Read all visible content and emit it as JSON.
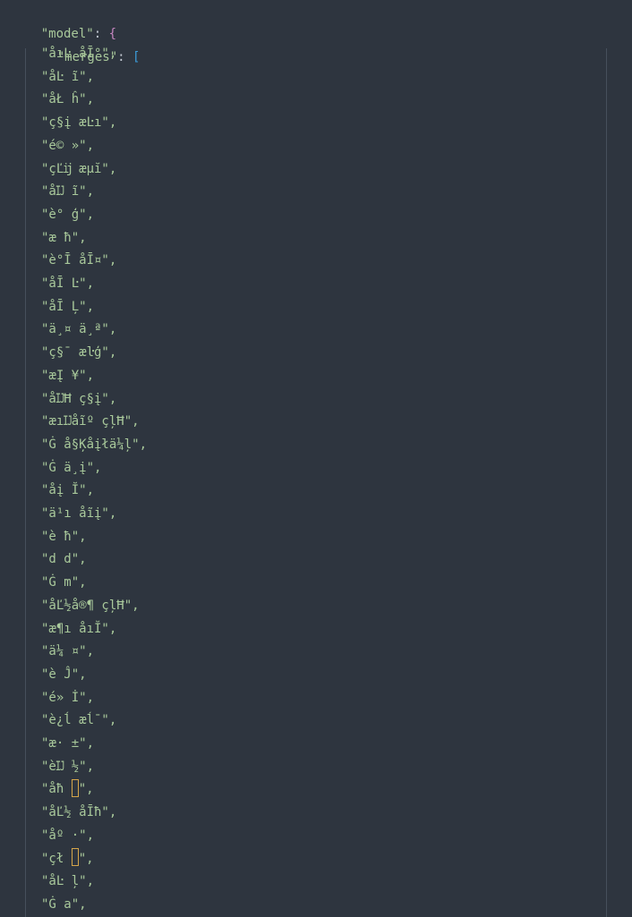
{
  "editor": {
    "model_key": "\"model\"",
    "merges_key": "\"merges\"",
    "colon": ": ",
    "open_brace": "{",
    "open_bracket": "[",
    "merges": [
      "\"åıĿ åĪ°\",",
      "\"åĿ ĩ\",",
      "\"åŁ ĥ\",",
      "\"ç§į æĿı\",",
      "\"é© »\",",
      "\"çĽĳ æµĭ\",",
      "\"åĲ ĩ\",",
      "\"è° ģ\",",
      "\"æ ħ\",",
      "\"è°Ī åĪ¤\",",
      "\"åĪ Ŀ\",",
      "\"åĪ Ļ\",",
      "\"ä¸¤ ä¸ª\",",
      "\"ç§¯ æŀģ\",",
      "\"æĮ ¥\",",
      "\"åĲĦ ç§į\",",
      "\"æıĲåĩº çļĦ\",",
      "\"Ġ å§Ķåįłä¼ļ\",",
      "\"Ġ ä¸į\",",
      "\"åį Ĭ\",",
      "\"ä¹ı åĩį\",",
      "\"è ħ\",",
      "\"d d\",",
      "\"Ġ m\",",
      "\"åĽ½å®¶ çļĦ\",",
      "\"æ¶ı åıĬ\",",
      "\"ä¼ ¤\",",
      "\"è Ĵ\",",
      "\"é» İ\",",
      "\"è¿ĺ æĺ¯\",",
      "\"æ· ±\",",
      "\"èĲ ½\",",
      "\"åħ ",
      "\"åĽ½ åĪħ\",",
      "\"åº ·\",",
      "\"çł ",
      "\"åĿ ļ\",",
      "\"Ġ a\","
    ],
    "boxed_suffix_1": "\",",
    "boxed_suffix_2": "\","
  }
}
